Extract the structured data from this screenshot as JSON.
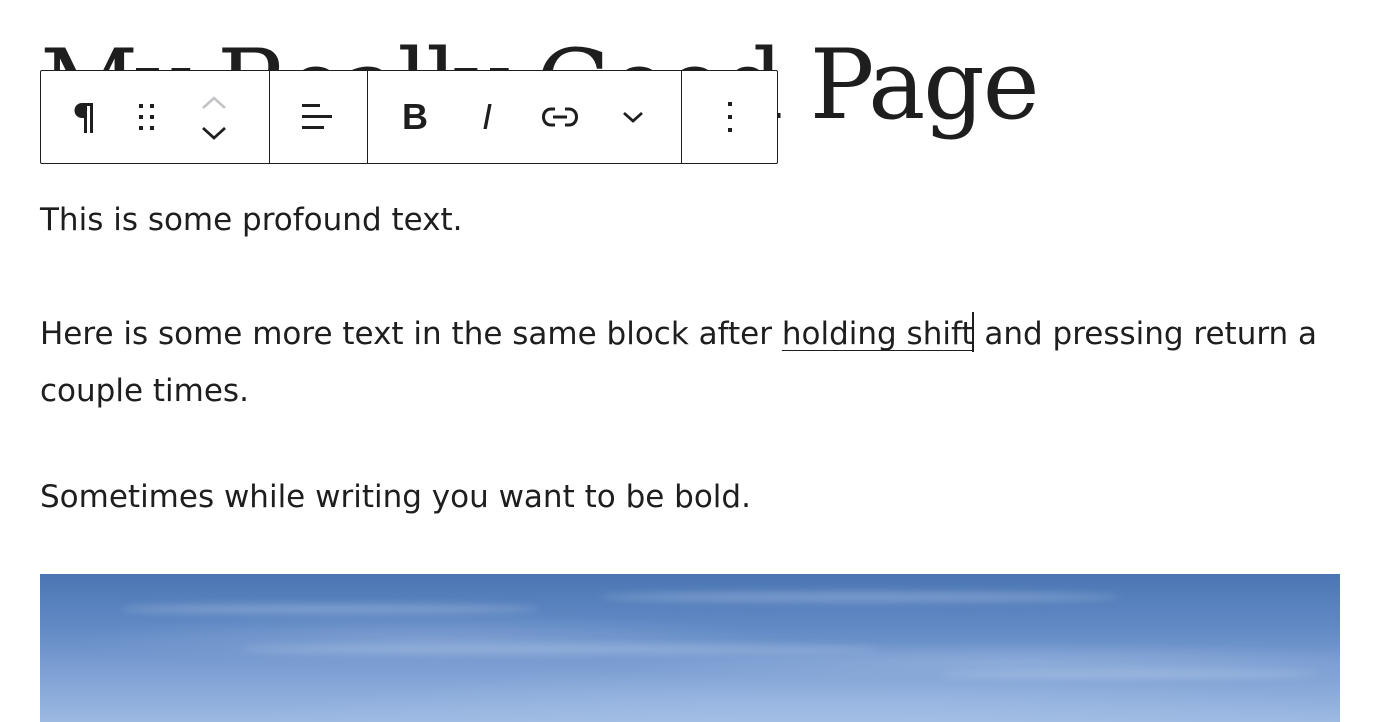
{
  "page": {
    "title": "My Really Good Page"
  },
  "toolbar": {
    "paragraph_icon": "paragraph-icon",
    "drag_icon": "drag-handle-icon",
    "move_up_icon": "chevron-up-icon",
    "move_down_icon": "chevron-down-icon",
    "align_icon": "align-left-icon",
    "bold_label": "B",
    "italic_label": "I",
    "link_icon": "link-icon",
    "more_format_icon": "chevron-down-icon",
    "options_icon": "vertical-ellipsis-icon"
  },
  "content": {
    "paragraph1": "This is some profound text.",
    "paragraph2_before_link": "Here is some more text in the same block after ",
    "paragraph2_link": "holding shift",
    "paragraph2_after_link": " and pressing return a couple times.",
    "paragraph3": "Sometimes while writing you want to be bold."
  },
  "colors": {
    "text": "#1e1e1e",
    "background": "#ffffff",
    "toolbar_border": "#1e1e1e",
    "disabled_icon": "#c3c4c7",
    "sky_top": "#4b76b3",
    "sky_bottom": "#9cb9e2"
  }
}
